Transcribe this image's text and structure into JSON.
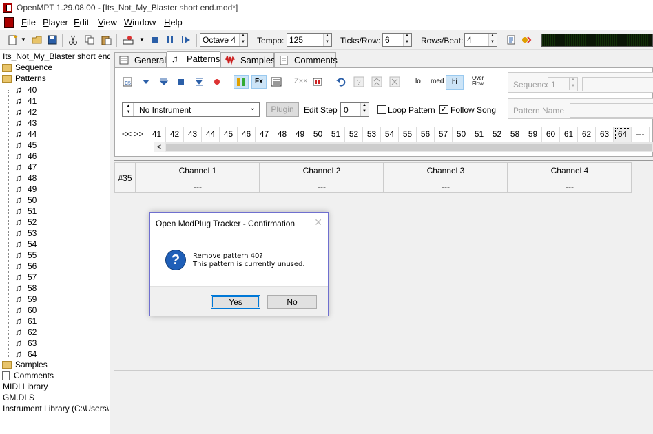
{
  "window": {
    "title": "OpenMPT 1.29.08.00 - [Its_Not_My_Blaster short end.mod*]"
  },
  "menubar": {
    "items": [
      "File",
      "Player",
      "Edit",
      "View",
      "Window",
      "Help"
    ]
  },
  "toolbar": {
    "octave": "Octave 4",
    "tempo_label": "Tempo:",
    "tempo_value": "125",
    "ticks_label": "Ticks/Row:",
    "ticks_value": "6",
    "rows_label": "Rows/Beat:",
    "rows_value": "4"
  },
  "tree": {
    "root": "Its_Not_My_Blaster short end.mod",
    "sequence": "Sequence",
    "patterns": "Patterns",
    "pattern_items": [
      "40",
      "41",
      "42",
      "43",
      "44",
      "45",
      "46",
      "47",
      "48",
      "49",
      "50",
      "51",
      "52",
      "53",
      "54",
      "55",
      "56",
      "57",
      "58",
      "59",
      "60",
      "61",
      "62",
      "63",
      "64"
    ],
    "samples": "Samples",
    "comments": "Comments",
    "midi": "MIDI Library",
    "gm": "GM.DLS",
    "instrument_lib": "Instrument Library (C:\\Users\\Emb"
  },
  "tabs": [
    "General",
    "Patterns",
    "Samples",
    "Comments"
  ],
  "patterns_panel": {
    "btn_lo": "lo",
    "btn_med": "med",
    "btn_hi": "hi",
    "btn_overflow": "Over Flow",
    "sequence_label": "Sequence",
    "sequence_value": "1",
    "instrument": "No Instrument",
    "plugin": "Plugin",
    "edit_step_label": "Edit Step",
    "edit_step_value": "0",
    "loop_pattern": "Loop Pattern",
    "follow_song": "Follow Song",
    "pattern_name_label": "Pattern Name",
    "order_nav": [
      "<<",
      ">>"
    ],
    "order_list": [
      "41",
      "42",
      "43",
      "44",
      "45",
      "46",
      "47",
      "48",
      "49",
      "50",
      "51",
      "52",
      "53",
      "54",
      "55",
      "56",
      "57",
      "50",
      "51",
      "52",
      "58",
      "59",
      "60",
      "61",
      "62",
      "63",
      "64",
      "---"
    ]
  },
  "pattern_view": {
    "row_number": "#35",
    "channels": [
      {
        "name": "Channel 1",
        "value": "---"
      },
      {
        "name": "Channel 2",
        "value": "---"
      },
      {
        "name": "Channel 3",
        "value": "---"
      },
      {
        "name": "Channel 4",
        "value": "---"
      }
    ]
  },
  "dialog": {
    "title": "Open ModPlug Tracker - Confirmation",
    "close": "✕",
    "icon": "?",
    "line1": "Remove pattern 40?",
    "line2": "This pattern is currently unused.",
    "yes": "Yes",
    "no": "No"
  },
  "colors": {
    "accent": "#0078d7",
    "dialog_border": "#6f6fcf",
    "question_icon": "#1f5fb8",
    "vu_background": "#0d1a06"
  }
}
